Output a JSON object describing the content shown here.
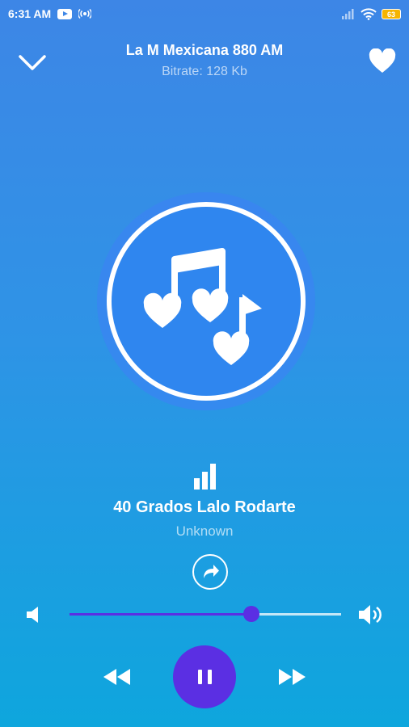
{
  "status_bar": {
    "time": "6:31 AM",
    "battery": "63",
    "icons": [
      "youtube-icon",
      "broadcast-icon",
      "signal-icon",
      "wifi-icon",
      "battery-icon"
    ]
  },
  "header": {
    "station_name": "La M Mexicana 880 AM",
    "bitrate": "Bitrate: 128 Kb",
    "left_icon": "chevron-down-icon",
    "right_icon": "heart-icon"
  },
  "track": {
    "title": "40 Grados Lalo Rodarte",
    "artist": "Unknown"
  },
  "controls": {
    "volume_level": 0.67,
    "state": "playing",
    "icons": [
      "rewind-icon",
      "pause-icon",
      "fast-forward-icon",
      "volume-down-icon",
      "volume-up-icon",
      "share-icon"
    ]
  },
  "colors": {
    "accent": "#5b2fe3",
    "art_bg": "#2f86ef"
  }
}
